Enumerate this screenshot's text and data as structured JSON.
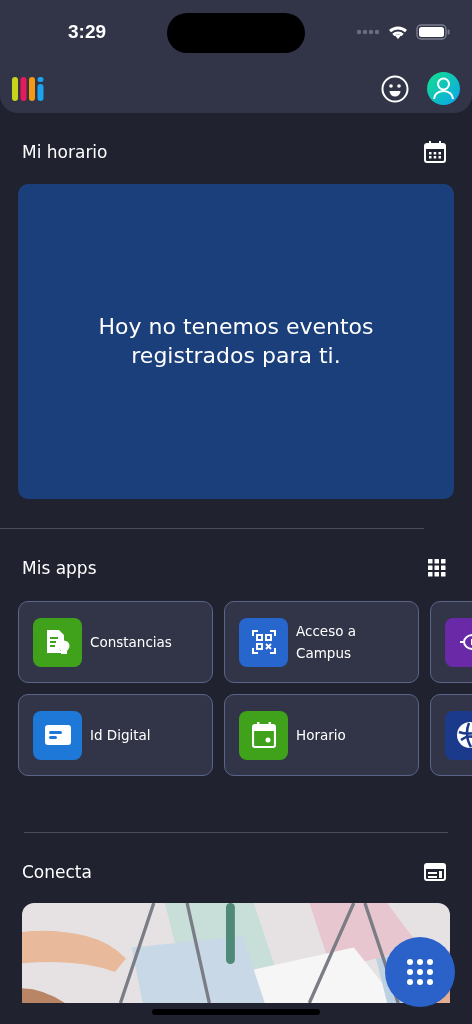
{
  "status_bar": {
    "time": "3:29"
  },
  "schedule": {
    "title": "Mi horario",
    "empty_message": "Hoy no tenemos eventos registrados para ti."
  },
  "apps": {
    "title": "Mis apps",
    "items": [
      {
        "label": "Constancias",
        "color": "#3fa21a"
      },
      {
        "label": "Id Digital",
        "color": "#1e78d8"
      },
      {
        "label": "Acceso a Campus",
        "color": "#2766cc"
      },
      {
        "label": "Horario",
        "color": "#3fa21a"
      },
      {
        "color": "#6a2aa8"
      },
      {
        "color": "#1c3a8c"
      }
    ]
  },
  "connect": {
    "title": "Conecta"
  }
}
